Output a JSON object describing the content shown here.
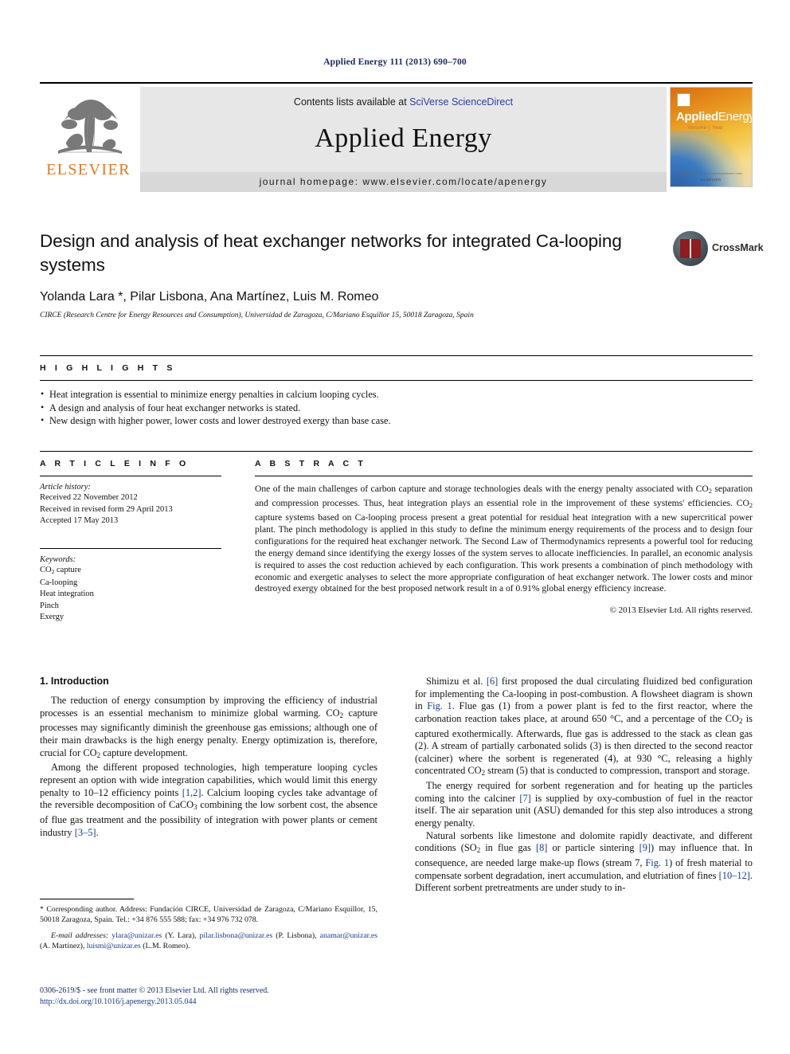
{
  "running_head": "Applied Energy 111 (2013) 690–700",
  "masthead": {
    "publisher_name": "ELSEVIER",
    "contents_prefix": "Contents lists available at ",
    "contents_link": "SciVerse ScienceDirect",
    "journal_title": "Applied Energy",
    "homepage": "journal homepage: www.elsevier.com/locate/apenergy",
    "cover": {
      "title_bold": "Applied",
      "title_light": "Energy",
      "subtitle": "Volume | Year",
      "footer_top": "ScienceDirect www.sciencedirect.com",
      "footer_bottom": "ELSEVIER"
    }
  },
  "article": {
    "title": "Design and analysis of heat exchanger networks for integrated Ca-looping systems",
    "authors": "Yolanda Lara *, Pilar Lisbona, Ana Martínez, Luis M. Romeo",
    "affiliation": "CIRCE (Research Centre for Energy Resources and Consumption), Universidad de Zaragoza, C/Mariano Esquillor 15, 50018 Zaragoza, Spain",
    "crossmark_label": "CrossMark"
  },
  "highlights": {
    "label": "H I G H L I G H T S",
    "items": [
      "Heat integration is essential to minimize energy penalties in calcium looping cycles.",
      "A design and analysis of four heat exchanger networks is stated.",
      "New design with higher power, lower costs and lower destroyed exergy than base case."
    ]
  },
  "article_info": {
    "label": "A R T I C L E   I N F O",
    "history_label": "Article history:",
    "history": [
      "Received 22 November 2012",
      "Received in revised form 29 April 2013",
      "Accepted 17 May 2013"
    ],
    "keywords_label": "Keywords:",
    "keywords_html": [
      "CO<sub>2</sub> capture",
      "Ca-looping",
      "Heat integration",
      "Pinch",
      "Exergy"
    ]
  },
  "abstract": {
    "label": "A B S T R A C T",
    "text_html": "One of the main challenges of carbon capture and storage technologies deals with the energy penalty associated with CO<sub>2</sub> separation and compression processes. Thus, heat integration plays an essential role in the improvement of these systems' efficiencies. CO<sub>2</sub> capture systems based on Ca-looping process present a great potential for residual heat integration with a new supercritical power plant. The pinch methodology is applied in this study to define the minimum energy requirements of the process and to design four configurations for the required heat exchanger network. The Second Law of Thermodynamics represents a powerful tool for reducing the energy demand since identifying the exergy losses of the system serves to allocate inefficiencies. In parallel, an economic analysis is required to asses the cost reduction achieved by each configuration. This work presents a combination of pinch methodology with economic and exergetic analyses to select the more appropriate configuration of heat exchanger network. The lower costs and minor destroyed exergy obtained for the best proposed network result in a of 0.91% global energy efficiency increase.",
    "copyright": "© 2013 Elsevier Ltd. All rights reserved."
  },
  "body": {
    "section_heading": "1. Introduction",
    "left_paragraphs_html": [
      "The reduction of energy consumption by improving the efficiency of industrial processes is an essential mechanism to minimize global warming. CO<sub>2</sub> capture processes may significantly diminish the greenhouse gas emissions; although one of their main drawbacks is the high energy penalty. Energy optimization is, therefore, crucial for CO<sub>2</sub> capture development.",
      "Among the different proposed technologies, high temperature looping cycles represent an option with wide integration capabilities, which would limit this energy penalty to 10–12 efficiency points <span class=\"ref\">[1,2]</span>. Calcium looping cycles take advantage of the reversible decomposition of CaCO<sub>3</sub> combining the low sorbent cost, the absence of flue gas treatment and the possibility of integration with power plants or cement industry <span class=\"ref\">[3–5]</span>."
    ],
    "right_paragraphs_html": [
      "Shimizu et al. <span class=\"ref\">[6]</span> first proposed the dual circulating fluidized bed configuration for implementing the Ca-looping in post-combustion. A flowsheet diagram is shown in <span class=\"ref\">Fig. 1</span>. Flue gas (1) from a power plant is fed to the first reactor, where the carbonation reaction takes place, at around 650 °C, and a percentage of the CO<sub>2</sub> is captured exothermically. Afterwards, flue gas is addressed to the stack as clean gas (2). A stream of partially carbonated solids (3) is then directed to the second reactor (calciner) where the sorbent is regenerated (4), at 930 °C, releasing a highly concentrated CO<sub>2</sub> stream (5) that is conducted to compression, transport and storage.",
      "The energy required for sorbent regeneration and for heating up the particles coming into the calciner <span class=\"ref\">[7]</span> is supplied by oxy-combustion of fuel in the reactor itself. The air separation unit (ASU) demanded for this step also introduces a strong energy penalty.",
      "Natural sorbents like limestone and dolomite rapidly deactivate, and different conditions (SO<sub>2</sub> in flue gas <span class=\"ref\">[8]</span> or particle sintering <span class=\"ref\">[9]</span>) may influence that. In consequence, are needed large make-up flows (stream 7, <span class=\"ref\">Fig. 1</span>) of fresh material to compensate sorbent degradation, inert accumulation, and elutriation of fines <span class=\"ref\">[10–12]</span>. Different sorbent pretreatments are under study to in-"
    ]
  },
  "footnotes": {
    "corresponding_html": "* Corresponding author. Address: Fundación CIRCE, Universidad de Zaragoza, C/Mariano Esquillor, 15, 50018 Zaragoza, Spain. Tel.: +34 876 555 588; fax: +34 976 732 078.",
    "email_label": "E-mail addresses:",
    "emails_html": "<span class=\"link\">ylara@unizar.es</span> (Y. Lara), <span class=\"link\">pilar.lisbona@unizar.es</span> (P. Lisbona), <span class=\"link\">anamar@unizar.es</span> (A. Martínez), <span class=\"link\">luismi@unizar.es</span> (L.M. Romeo)."
  },
  "imprint": {
    "line1": "0306-2619/$ - see front matter © 2013 Elsevier Ltd. All rights reserved.",
    "line2": "http://dx.doi.org/10.1016/j.apenergy.2013.05.044"
  }
}
